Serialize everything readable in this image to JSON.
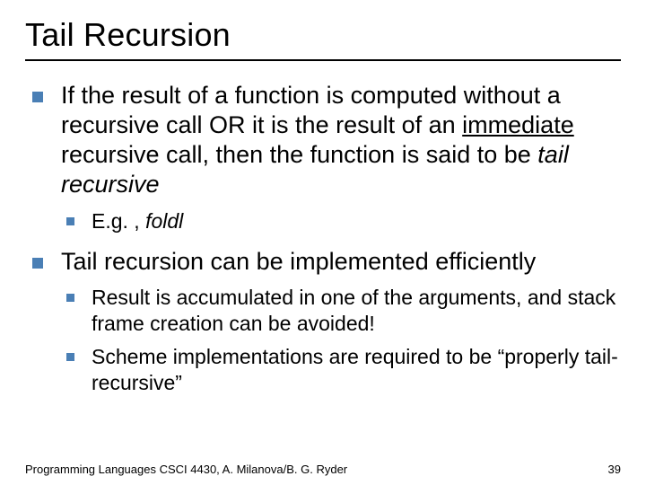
{
  "title": "Tail Recursion",
  "bullets": [
    {
      "text_parts": {
        "a": "If the result of a function is computed without a recursive call OR it is the result of an ",
        "b_underlined": "immediate",
        "c": " recursive call, then the function is said to be ",
        "d_italic": "tail recursive"
      },
      "sub": [
        {
          "a": "E.g. , ",
          "b_italic": "foldl"
        }
      ]
    },
    {
      "text_parts": {
        "a": "Tail recursion can be implemented efficiently"
      },
      "sub": [
        {
          "a": "Result is accumulated in one of the arguments, and stack frame creation can be avoided!"
        },
        {
          "a": "Scheme implementations are required to be “properly tail-recursive”"
        }
      ]
    }
  ],
  "footer": {
    "left": "Programming Languages CSCI 4430, A. Milanova/B. G. Ryder",
    "page": "39"
  }
}
